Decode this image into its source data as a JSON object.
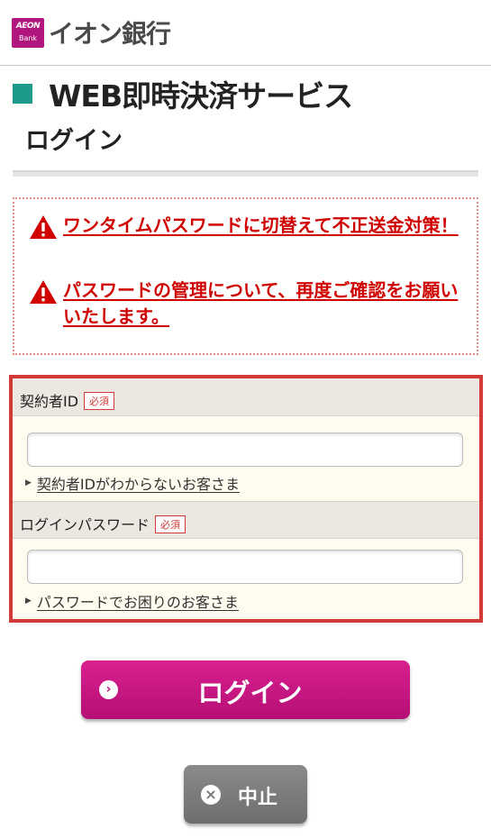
{
  "header": {
    "logo_brand": "AEON",
    "logo_sub": "Bank",
    "bank_name": "イオン銀行"
  },
  "page": {
    "title": "WEB即時決済サービス",
    "subtitle": "ログイン"
  },
  "notices": [
    {
      "text": "ワンタイムパスワードに切替えて不正送金対策！",
      "icon": "warning-icon"
    },
    {
      "text": "パスワードの管理について、再度ご確認をお願いいたします。",
      "icon": "warning-icon"
    }
  ],
  "form": {
    "contract_id": {
      "label": "契約者ID",
      "required": "必須",
      "value": "",
      "help": "契約者IDがわからないお客さま"
    },
    "password": {
      "label": "ログインパスワード",
      "required": "必須",
      "value": "",
      "help": "パスワードでお困りのお客さま"
    }
  },
  "buttons": {
    "login": "ログイン",
    "cancel": "中止"
  },
  "colors": {
    "brand": "#b0167d",
    "title_accent": "#1e9a8a",
    "notice_text": "#d00000",
    "form_border": "#d13a36",
    "login_button": "#c8137f",
    "cancel_button": "#7a7a7a"
  }
}
